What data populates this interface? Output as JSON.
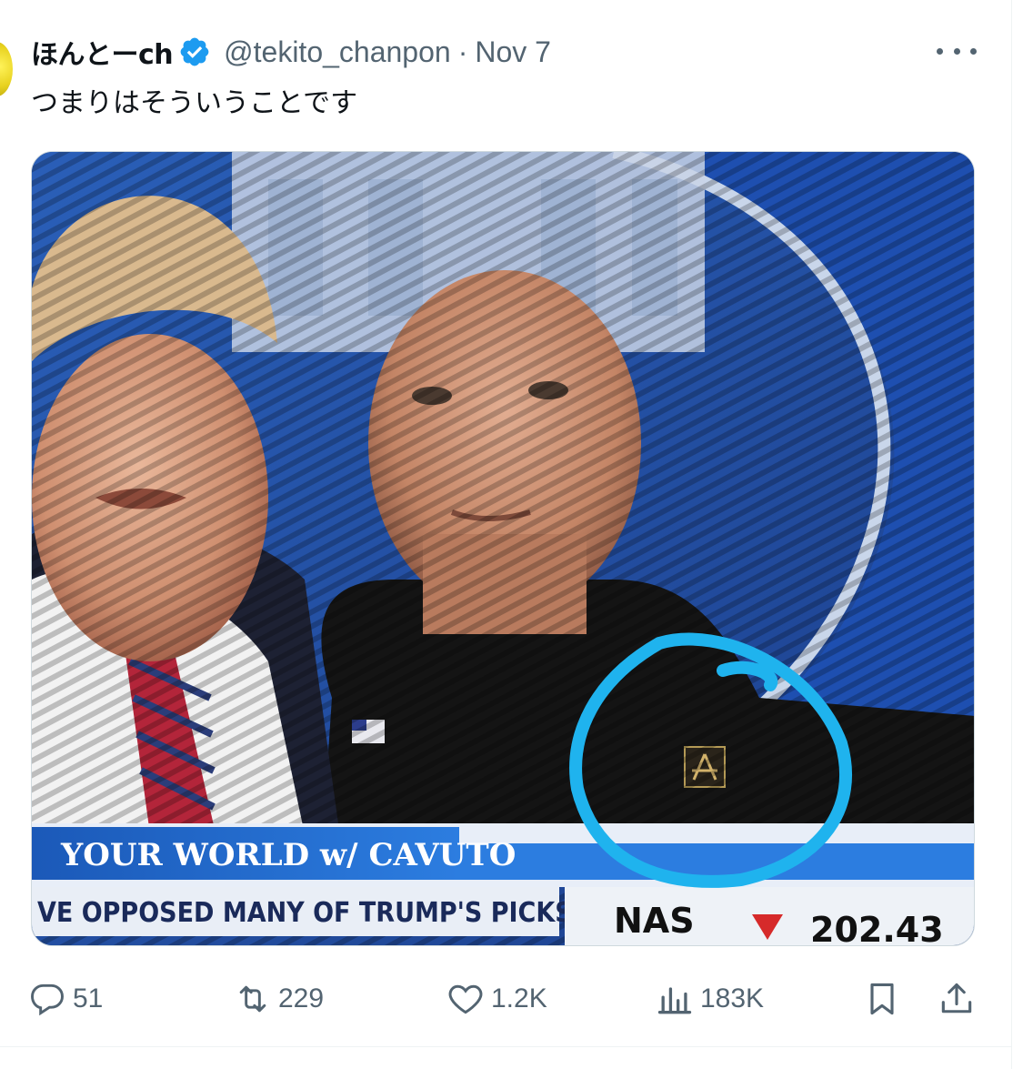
{
  "tweet": {
    "display_name": "ほんとーch",
    "verified_icon": "verified-badge-icon",
    "handle": "@tekito_chanpon",
    "separator": "·",
    "date": "Nov 7",
    "text": "つまりはそういうことです"
  },
  "media": {
    "chyron_title": "YOUR WORLD w/ CAVUTO",
    "chyron_ticker": "VE OPPOSED MANY OF TRUMP'S PICKS",
    "market_label": "NAS",
    "market_value": "202.43",
    "annotation_color": "#1fb3ee",
    "chyron_blue": "#1b59b8"
  },
  "actions": {
    "replies": "51",
    "reposts": "229",
    "likes": "1.2K",
    "views": "183K"
  },
  "colors": {
    "text_primary": "#0f1419",
    "text_secondary": "#536471",
    "verified_blue": "#1d9bf0",
    "border": "#eff3f4"
  }
}
